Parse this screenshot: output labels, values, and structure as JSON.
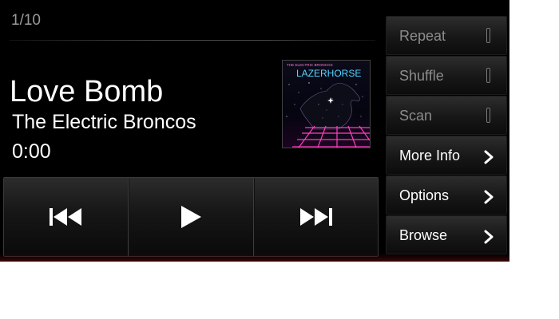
{
  "track": {
    "counter": "1/10",
    "title": "Love Bomb",
    "artist": "The Electric Broncos",
    "elapsed": "0:00"
  },
  "album_art": {
    "band_text": "THE ELECTRIC BRONCOS",
    "album_text": "LAZERHORSE"
  },
  "transport": [
    {
      "name": "previous-button",
      "icon": "skip-back-icon"
    },
    {
      "name": "play-button",
      "icon": "play-icon"
    },
    {
      "name": "next-button",
      "icon": "skip-forward-icon"
    }
  ],
  "side_menu": {
    "toggles": [
      {
        "label": "Repeat",
        "enabled": false
      },
      {
        "label": "Shuffle",
        "enabled": false
      },
      {
        "label": "Scan",
        "enabled": false
      }
    ],
    "nav": [
      {
        "label": "More Info",
        "icon": "chevron-right-icon"
      },
      {
        "label": "Options",
        "icon": "chevron-right-icon"
      },
      {
        "label": "Browse",
        "icon": "chevron-right-icon"
      }
    ]
  },
  "colors": {
    "background": "#000000",
    "primary_text": "#ffffff",
    "muted_text": "#9a9a9a",
    "album_grid": "#ff3fbf",
    "album_title": "#55d6ff"
  }
}
